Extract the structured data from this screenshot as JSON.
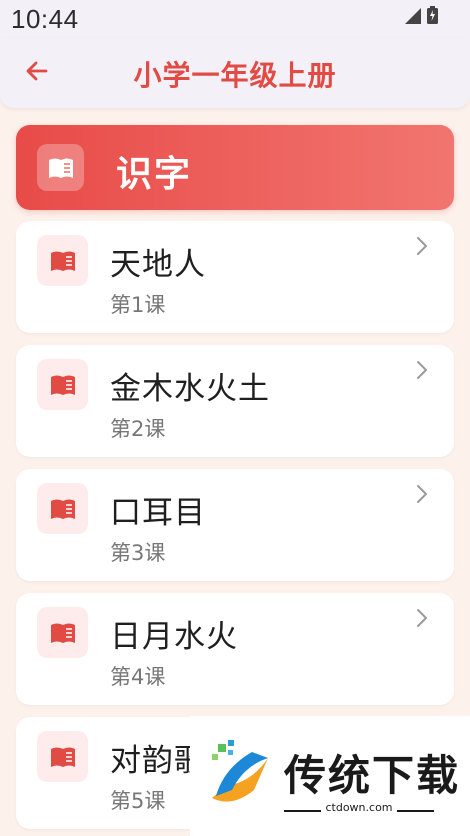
{
  "status_bar": {
    "time": "10:44"
  },
  "app_bar": {
    "title": "小学一年级上册",
    "back_icon": "arrow-left-icon"
  },
  "section": {
    "label": "识字",
    "icon": "book-open-icon"
  },
  "lessons": [
    {
      "name": "天地人",
      "lesson": "第1课"
    },
    {
      "name": "金木水火土",
      "lesson": "第2课"
    },
    {
      "name": "口耳目",
      "lesson": "第3课"
    },
    {
      "name": "日月水火",
      "lesson": "第4课"
    },
    {
      "name": "对韵歌",
      "lesson": "第5课"
    }
  ],
  "watermark": {
    "brand": "传统下载",
    "url": "ctdown.com"
  },
  "colors": {
    "accent": "#e24a44",
    "background": "#fdf1ec",
    "app_bar": "#f3f0f8"
  }
}
